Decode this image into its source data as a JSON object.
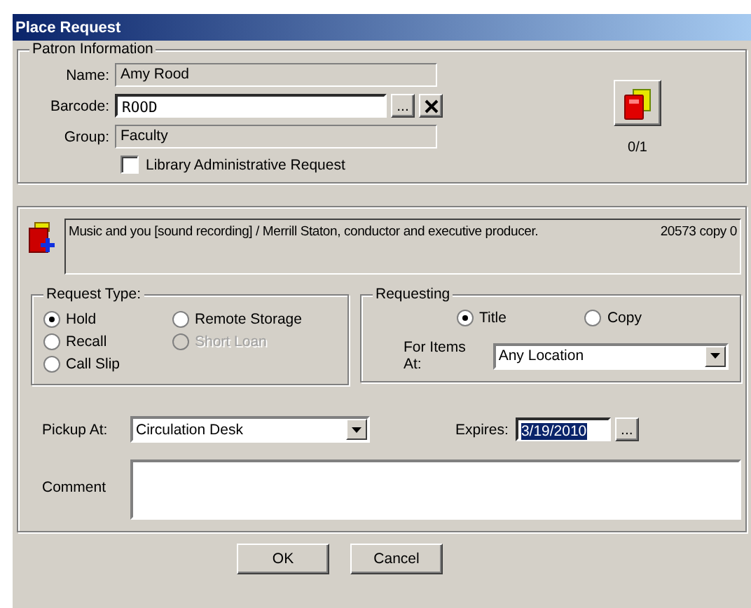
{
  "window": {
    "title": "Place Request"
  },
  "patron": {
    "legend": "Patron Information",
    "name_label": "Name:",
    "name": "Amy Rood",
    "barcode_label": "Barcode:",
    "barcode": "ROOD",
    "browse": "...",
    "group_label": "Group:",
    "group": "Faculty",
    "admin_request": {
      "label": "Library Administrative Request",
      "checked": false
    },
    "count": "0/1"
  },
  "item": {
    "title": "Music and you [sound recording] / Merrill Staton, conductor and executive producer.",
    "copy": "20573 copy 0"
  },
  "request_type": {
    "legend": "Request Type:",
    "options": [
      {
        "label": "Hold",
        "selected": true,
        "disabled": false
      },
      {
        "label": "Recall",
        "selected": false,
        "disabled": false
      },
      {
        "label": "Call Slip",
        "selected": false,
        "disabled": false
      },
      {
        "label": "Remote Storage",
        "selected": false,
        "disabled": false
      },
      {
        "label": "Short Loan",
        "selected": false,
        "disabled": true
      }
    ]
  },
  "requesting": {
    "legend": "Requesting",
    "options": [
      {
        "label": "Title",
        "selected": true
      },
      {
        "label": "Copy",
        "selected": false
      }
    ],
    "for_items_label": "For Items At:",
    "for_items": "Any Location"
  },
  "pickup": {
    "label": "Pickup At:",
    "value": "Circulation Desk"
  },
  "expires": {
    "label": "Expires:",
    "value": "3/19/2010",
    "highlighted": true,
    "browse": "..."
  },
  "comment": {
    "label": "Comment"
  },
  "buttons": [
    "OK",
    "Cancel"
  ]
}
